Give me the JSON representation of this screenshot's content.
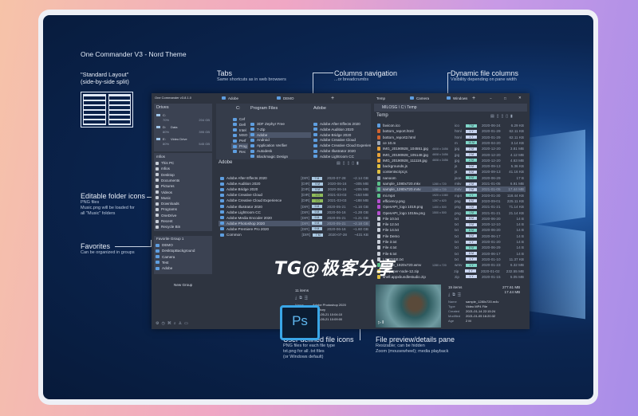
{
  "annotations": {
    "title": "One Commander V3 - Nord Theme",
    "layout": {
      "h1": "\"Standard Layout\"",
      "h2": "(side-by-side split)"
    },
    "tabs": {
      "h": "Tabs",
      "s": "Same shortcuts as in web browsers"
    },
    "columns": {
      "h": "Columns navigation",
      "s": "...or breadcrumbs"
    },
    "dynamic": {
      "h": "Dynamic file columns",
      "s": "Visibility depending on pane width"
    },
    "folder_icons": {
      "h": "Editable folder icons",
      "s1": "PNG files",
      "s2": "Music.png will be loaded for",
      "s3": "all \"Music\" folders"
    },
    "favorites": {
      "h": "Favorites",
      "s": "Can be organized in groups"
    },
    "file_icons": {
      "h": "User defined file icons",
      "s1": "PNG files for each file type",
      "s2": "txt.png for all .txt files",
      "s3": "(or Windows default)"
    },
    "preview": {
      "h": "File preview/details pane",
      "s1": "Resizable; can be hidden",
      "s2": "Zoom (mousewheel); media playback"
    }
  },
  "watermark": "TG@极客分享",
  "ps_icon": "Ps",
  "app": {
    "title": "One Commander v3.8.1.0",
    "left_tabs": [
      "Adobe",
      "DEMO",
      "+"
    ],
    "right_tabs": [
      "Temp",
      "Camera",
      "Windows",
      "+"
    ],
    "window_controls": [
      "−",
      "□",
      "✕"
    ],
    "drives_title": "Drives",
    "drives": [
      {
        "letter": "C:",
        "label": "",
        "pct": "70%",
        "size": "204 GB"
      },
      {
        "letter": "D:",
        "label": "Data",
        "pct": "80%",
        "size": "395 GB"
      },
      {
        "letter": "E:",
        "label": "Video Drive",
        "pct": "80%",
        "size": "545 GB"
      }
    ],
    "folders_title": "mfios",
    "folders": [
      "This PC",
      "mfios",
      "Desktop",
      "Documents",
      "Pictures",
      "Videos",
      "Music",
      "Downloads",
      "Programs",
      "OneDrive",
      "Recent",
      "Recycle Bin"
    ],
    "fav_title": "Favorite Group 1",
    "favorites": [
      "DEMO",
      "DesktopBackground",
      "Camera",
      "Test",
      "Adobe"
    ],
    "new_group": "New Group",
    "col_c": {
      "title": "C:",
      "items": [
        "Cef",
        "Dell",
        "Intel",
        "MSO",
        "Perf",
        "Prog",
        "Rec"
      ]
    },
    "col_pf": {
      "title": "Program Files",
      "items": [
        "3DF Zephyr Free",
        "7-Zip",
        "Adobe",
        "Android",
        "Application Verifier",
        "Autodesk",
        "Blackmagic Design"
      ]
    },
    "col_adobe": {
      "title": "Adobe",
      "items": [
        "Adobe After Effects 2020",
        "Adobe Audition 2020",
        "Adobe Bridge 2020",
        "Adobe Creative Cloud",
        "Adobe Creative Cloud Experience",
        "Adobe Illustrator 2020",
        "Adobe Lightroom CC"
      ]
    },
    "left_pane_title": "Adobe",
    "left_files": [
      [
        "Adobe After Effects 2020",
        "[DIR]",
        "7 M",
        "2020-07-28",
        "~2.14 GB",
        ""
      ],
      [
        "Adobe Audition 2020",
        "[DIR]",
        "9 M",
        "2020-06-16",
        "~305 MB",
        ""
      ],
      [
        "Adobe Bridge 2020",
        "[DIR]",
        "9 M",
        "2020-06-16",
        "~205 MB",
        ""
      ],
      [
        "Adobe Creative Cloud",
        "[DIR]",
        "1 D",
        "2021-03-03",
        "~153 MB",
        "g"
      ],
      [
        "Adobe Creative Cloud Experience",
        "[DIR]",
        "1 D",
        "2021-03-03",
        "~188 MB",
        "g"
      ],
      [
        "Adobe Illustrator 2020",
        "[DIR]",
        "9 M",
        "2020-05-21",
        "~1.16 GB",
        ""
      ],
      [
        "Adobe Lightroom CC",
        "[DIR]",
        "9 M",
        "2020-06-16",
        "~1.28 GB",
        ""
      ],
      [
        "Adobe Media Encoder 2020",
        "[DIR]",
        "9 M",
        "2020-05-21",
        "~1.21 GB",
        ""
      ],
      [
        "Adobe Photoshop 2020",
        "[DIR]",
        "9 M",
        "2020-05-21",
        "~2.18 GB",
        "sel"
      ],
      [
        "Adobe Premiere Pro 2020",
        "[DIR]",
        "9 M",
        "2020-06-16",
        "~1.60 GB",
        ""
      ],
      [
        "Common",
        "[DIR]",
        "7 M",
        "2020-07-28",
        "~431 KB",
        ""
      ]
    ],
    "left_details": {
      "count": "11 items",
      "rows": [
        [
          "Name",
          "Adobe Photoshop 2020"
        ],
        [
          "Type",
          "Directory"
        ],
        [
          "Created",
          "2020-05-21 10:04:10"
        ],
        [
          "Modified",
          "2020-05-21 10:09:00"
        ],
        [
          "Age",
          "9 M"
        ]
      ]
    },
    "path": "MILOSG \\ C:\\ Temp",
    "right_pane_title": "Temp",
    "right_files": [
      [
        "favicon.ico",
        "",
        "ico",
        "7 M",
        "2020-06-24",
        "6.29 KB",
        "#5e9ee0",
        ""
      ],
      [
        "bottom_report.html",
        "",
        "html",
        "1 Y",
        "2020-01-29",
        "62.11 KB",
        "#d0632f",
        ""
      ],
      [
        "bottom_report2.html",
        "",
        "html",
        "1 Y",
        "2020-01-29",
        "62.11 KB",
        "#d0632f",
        ""
      ],
      [
        "ce 10.m",
        "",
        "m",
        "10 M",
        "2020-04-20",
        "3.14 KB",
        "#9aa6b8",
        ""
      ],
      [
        "IMG_20190928_104551.jpg",
        "4608 x 3456",
        "jpg",
        "2 M",
        "2020-12-20",
        "3.81 MB",
        "#e8a33a",
        ""
      ],
      [
        "IMG_20190928_105148.jpg",
        "4608 x 3456",
        "jpg",
        "2 M",
        "2020-12-20",
        "4.12 MB",
        "#e8a33a",
        ""
      ],
      [
        "IMG_20190928_111116.jpg",
        "4608 x 3456",
        "jpg",
        "2 M",
        "2020-12-20",
        "4.63 MB",
        "#e8a33a",
        ""
      ],
      [
        "backgrounds.js",
        "",
        "js",
        "5 M",
        "2020-09-13",
        "5.36 KB",
        "#e0c040",
        ""
      ],
      [
        "contentscript.js",
        "",
        "js",
        "5 M",
        "2020-09-13",
        "41.16 KB",
        "#e0c040",
        ""
      ],
      [
        "nanoom",
        "",
        "json",
        "8 M",
        "2020-06-29",
        "17 B",
        "#9aa6b8",
        ""
      ],
      [
        "sample_1080x720.mkv",
        "1280 x 720",
        "mkv",
        "2 M",
        "2021-01-05",
        "6.91 MB",
        "#5cc08a",
        ""
      ],
      [
        "sample_1280x720.m4v",
        "1280 x 720",
        "m4v",
        "2 M",
        "2021-01-05",
        "17.44 MB",
        "#5cc08a",
        "sel"
      ],
      [
        "mi.mp4",
        "1920 x 1080",
        "mp4",
        "1 Y",
        "2020-01-30",
        "118.44 KB",
        "#5cc08a",
        ""
      ],
      [
        "efficiency.png",
        "1397 x 620",
        "png",
        "6 M",
        "2020-09-01",
        "225.11 KB",
        "#b54fd0",
        ""
      ],
      [
        "OpenAPI_logo 1019.png",
        "1400 x 500",
        "png",
        "1 M",
        "2021-01-21",
        "71.14 KB",
        "#b54fd0",
        ""
      ],
      [
        "OpenAPI_logo 1019a.png",
        "1500 x 500",
        "png",
        "1 M",
        "2021-01-21",
        "21.14 KB",
        "#b54fd0",
        ""
      ],
      [
        "File 10.txt",
        "",
        "txt",
        "8 M",
        "2020-06-20",
        "14 B",
        "#c8ced8",
        ""
      ],
      [
        "File 12.txt",
        "",
        "txt",
        "3 M",
        "2020-12-10",
        "14 B",
        "#c8ced8",
        ""
      ],
      [
        "File 14.txt",
        "",
        "txt",
        "8 M",
        "2020-06-20",
        "14 B",
        "#c8ced8",
        ""
      ],
      [
        "File Demo",
        "",
        "txt",
        "8 M",
        "2020-06-17",
        "14 B",
        "#c8ced8",
        ""
      ],
      [
        "File 3.txt",
        "",
        "txt",
        "1 Y",
        "2020-01-20",
        "14 B",
        "#c8ced8",
        ""
      ],
      [
        "File 4.txt",
        "",
        "txt",
        "8 M",
        "2020-06-29",
        "14 B",
        "#c8ced8",
        ""
      ],
      [
        "File 6.txt",
        "",
        "txt",
        "8 M",
        "2020-06-17",
        "14 B",
        "#c8ced8",
        ""
      ],
      [
        "LICENSE.txt",
        "",
        "txt",
        "1 Y",
        "2020-01-10",
        "11.37 KB",
        "#c8ced8",
        ""
      ],
      [
        "sample_1920x720.wmv",
        "1280 x 720",
        "wmv",
        "1 Y",
        "2020-01-23",
        "6.32 MB",
        "#5cc08a",
        ""
      ],
      [
        "wallpaper-node-12.zip",
        "",
        "zip",
        "1 Y",
        "2020-01-02",
        "232.55 MB",
        "#e0c040",
        ""
      ],
      [
        "shell.appxbundlestudio.zip",
        "",
        "zip",
        "1 Y",
        "2020-01-15",
        "5.05 MB",
        "#e0c040",
        ""
      ]
    ],
    "right_details": {
      "count": "15 items",
      "total": "277.61 MB",
      "selected": "17.44 MB",
      "rows": [
        [
          "Name",
          "sample_1280x720.m4v"
        ],
        [
          "Type",
          "Video MP4 File"
        ],
        [
          "Created",
          "2021-01-14 22:15:24"
        ],
        [
          "Modified",
          "2021-01-05 16:20:32"
        ],
        [
          "Age",
          "2 M"
        ]
      ]
    }
  },
  "colors": {
    "app_bg": "#2e3440",
    "panel": "#3b4252",
    "selection": "#4c566a",
    "accent": "#5e9ee0"
  }
}
